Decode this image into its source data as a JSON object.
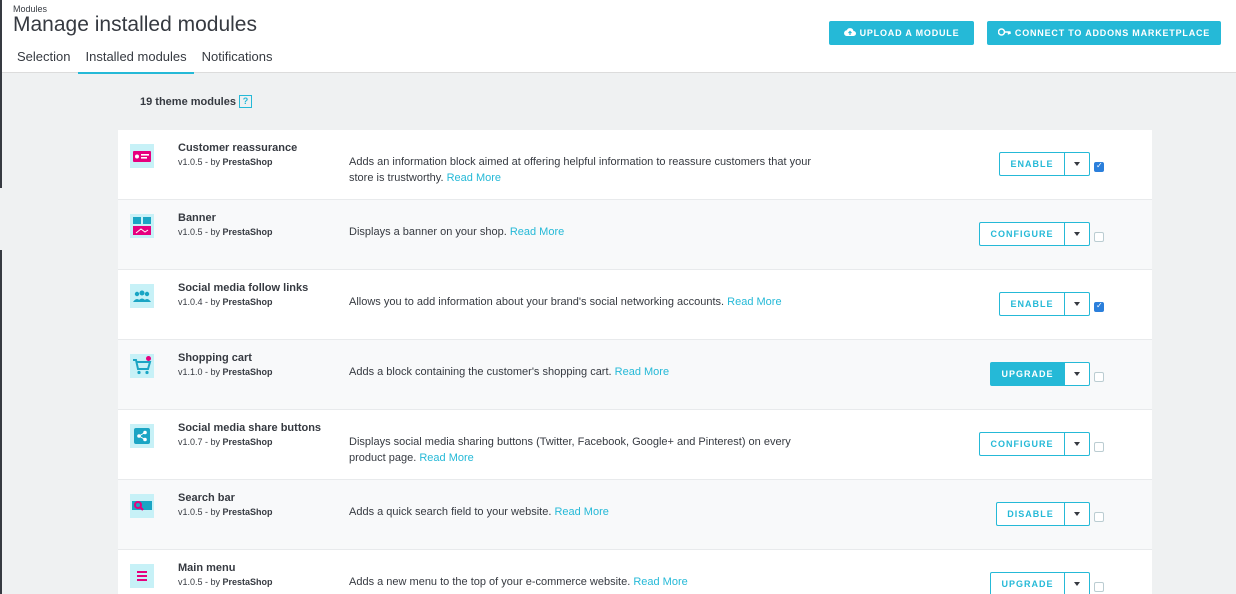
{
  "header": {
    "breadcrumb": "Modules",
    "title": "Manage installed modules",
    "tabs": [
      {
        "label": "Selection",
        "active": false
      },
      {
        "label": "Installed modules",
        "active": true
      },
      {
        "label": "Notifications",
        "active": false
      }
    ],
    "upload_label": "UPLOAD A MODULE",
    "connect_label": "CONNECT TO ADDONS MARKETPLACE"
  },
  "section": {
    "count_label": "19 theme modules",
    "help": "?"
  },
  "modules": [
    {
      "name": "Customer reassurance",
      "version": "v1.0.5 - by ",
      "author": "PrestaShop",
      "desc": "Adds an information block aimed at offering helpful information to reassure customers that your store is trustworthy.",
      "read_more": "Read More",
      "action": "ENABLE",
      "checked": true,
      "icon": "reassurance-icon"
    },
    {
      "name": "Banner",
      "version": "v1.0.5 - by ",
      "author": "PrestaShop",
      "desc": "Displays a banner on your shop.",
      "read_more": "Read More",
      "action": "CONFIGURE",
      "checked": false,
      "icon": "banner-icon"
    },
    {
      "name": "Social media follow links",
      "version": "v1.0.4 - by ",
      "author": "PrestaShop",
      "desc": "Allows you to add information about your brand's social networking accounts.",
      "read_more": "Read More",
      "action": "ENABLE",
      "checked": true,
      "icon": "social-follow-icon"
    },
    {
      "name": "Shopping cart",
      "version": "v1.1.0 - by ",
      "author": "PrestaShop",
      "desc": "Adds a block containing the customer's shopping cart.",
      "read_more": "Read More",
      "action": "UPGRADE",
      "checked": false,
      "icon": "cart-icon"
    },
    {
      "name": "Social media share buttons",
      "version": "v1.0.7 - by ",
      "author": "PrestaShop",
      "desc": "Displays social media sharing buttons (Twitter, Facebook, Google+ and Pinterest) on every product page.",
      "read_more": "Read More",
      "action": "CONFIGURE",
      "checked": false,
      "icon": "share-icon"
    },
    {
      "name": "Search bar",
      "version": "v1.0.5 - by ",
      "author": "PrestaShop",
      "desc": "Adds a quick search field to your website.",
      "read_more": "Read More",
      "action": "DISABLE",
      "checked": false,
      "icon": "search-bar-icon"
    },
    {
      "name": "Main menu",
      "version": "v1.0.5 - by ",
      "author": "PrestaShop",
      "desc": "Adds a new menu to the top of your e-commerce website.",
      "read_more": "Read More",
      "action": "UPGRADE",
      "checked": false,
      "icon": "menu-icon"
    }
  ],
  "colors": {
    "accent": "#25b9d7",
    "icon_pink": "#e6007e",
    "text": "#363a41"
  }
}
